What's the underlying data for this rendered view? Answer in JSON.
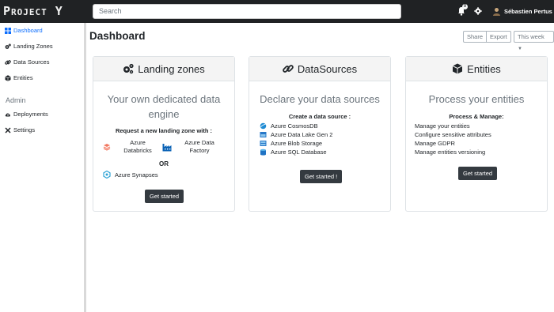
{
  "app": {
    "brand": "Project Y"
  },
  "topbar": {
    "search_placeholder": "Search",
    "notification_count": "0",
    "user_name": "Sébastien Pertus"
  },
  "sidebar": {
    "items": [
      {
        "label": "Dashboard",
        "icon": "dashboard-icon",
        "active": true
      },
      {
        "label": "Landing Zones",
        "icon": "gears-icon"
      },
      {
        "label": "Data Sources",
        "icon": "link-icon"
      },
      {
        "label": "Entities",
        "icon": "cube-icon"
      }
    ],
    "admin_title": "Admin",
    "admin_items": [
      {
        "label": "Deployments",
        "icon": "cloud-upload-icon"
      },
      {
        "label": "Settings",
        "icon": "tools-icon"
      }
    ]
  },
  "main": {
    "title": "Dashboard",
    "share_label": "Share",
    "export_label": "Export",
    "period_label": "This week"
  },
  "cards": {
    "landing": {
      "title": "Landing zones",
      "lead_line1": "Your own dedicated data",
      "lead_line2": "engine",
      "subtitle": "Request a new landing zone with :",
      "option1_line1": "Azure",
      "option1_line2": "Databricks",
      "option2_line1": "Azure Data",
      "option2_line2": "Factory",
      "or": "OR",
      "option3": "Azure Synapses",
      "button": "Get started"
    },
    "datasources": {
      "title": "DataSources",
      "lead": "Declare your data sources",
      "subtitle": "Create a data source :",
      "items": [
        "Azure CosmosDB",
        "Azure Data Lake Gen 2",
        "Azure Blob Storage",
        "Azure SQL Database"
      ],
      "button": "Get started !"
    },
    "entities": {
      "title": "Entities",
      "lead": "Process your entities",
      "subtitle": "Process & Manage:",
      "items": [
        "Manage your entities",
        "Configure sensitive attributes",
        "Manage GDPR",
        "Manage entities versioning"
      ],
      "button": "Get started"
    }
  }
}
